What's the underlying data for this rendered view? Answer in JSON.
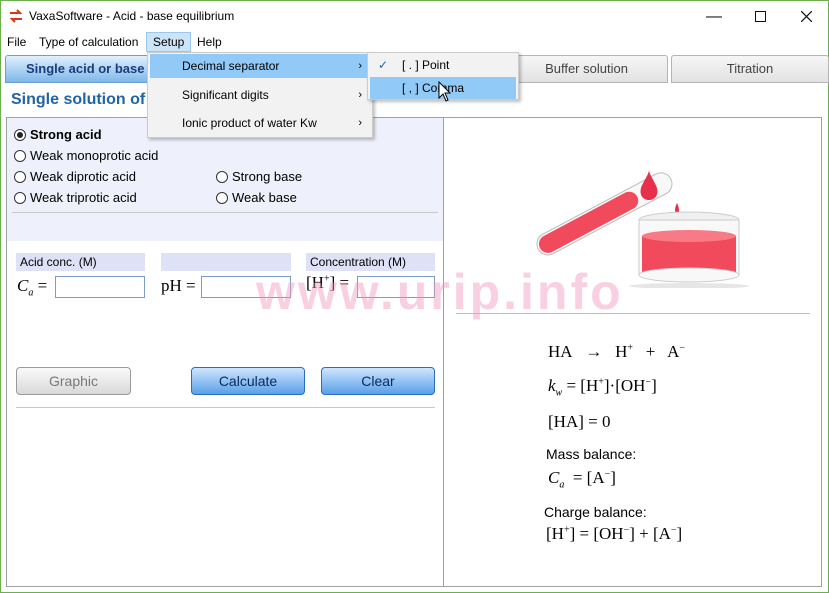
{
  "window": {
    "title": "VaxaSoftware - Acid - base equilibrium"
  },
  "menubar": {
    "file": "File",
    "type_of_calculation": "Type of calculation",
    "setup": "Setup",
    "help": "Help"
  },
  "setup_menu": {
    "items": [
      {
        "label": "Decimal separator"
      },
      {
        "label": "Significant digits"
      },
      {
        "label": "Ionic product of water Kw"
      }
    ]
  },
  "decimal_submenu": {
    "items": [
      {
        "label": "[ . ] Point",
        "checked": true
      },
      {
        "label": "[ , ] Comma",
        "checked": false
      }
    ]
  },
  "tabs": [
    {
      "label": "Single acid or base",
      "selected": true
    },
    {
      "label": "Buffer solution",
      "selected": false
    },
    {
      "label": "Titration",
      "selected": false
    }
  ],
  "section_title": "Single solution of",
  "options": {
    "strong_acid": "Strong acid",
    "weak_monoprotic": "Weak monoprotic acid",
    "weak_diprotic": "Weak diprotic acid",
    "weak_triprotic": "Weak triprotic acid",
    "strong_base": "Strong base",
    "weak_base": "Weak base",
    "selected": "Strong acid"
  },
  "inputs": {
    "acid_conc_label": "Acid conc. (M)",
    "concentration_label": "Concentration (M)",
    "ca_label": "= ",
    "ph_label": "pH =",
    "h_label": "=",
    "ca_value": "",
    "ph_value": "",
    "h_value": ""
  },
  "buttons": {
    "graphic": "Graphic",
    "calculate": "Calculate",
    "clear": "Clear"
  },
  "formulas": {
    "dissociation_ha": "HA",
    "dissociation_arrow": "→",
    "dissociation_h": "H",
    "dissociation_plus": "+",
    "dissociation_a": "A",
    "kw": "= [H",
    "kw_rest": "]·[OH",
    "kw_end": "]",
    "ha_zero": "[HA]  =  0",
    "mass_balance": "Mass balance:",
    "mass_eq": "=  [A",
    "mass_eq_end": "]",
    "charge_balance": "Charge balance:",
    "charge_eq": "[H",
    "charge_eq2": "] = [OH",
    "charge_eq3": "] + [A",
    "charge_eq4": "]"
  },
  "watermark": "www.urip.info",
  "colors": {
    "accent": "#1f64a6",
    "menu_highlight": "#91c9f7",
    "tab_selected": "#7fb7e8",
    "liquid": "#f04a5c"
  }
}
